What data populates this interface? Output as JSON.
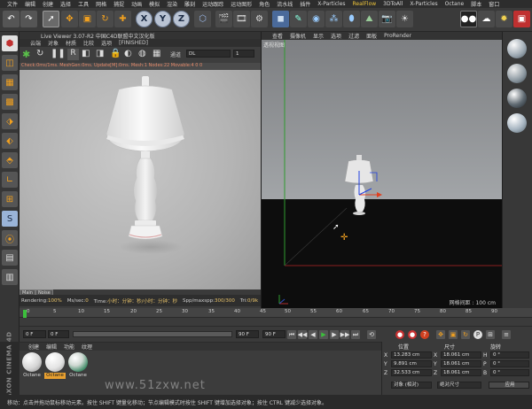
{
  "menubar": {
    "items": [
      "文件",
      "编辑",
      "创建",
      "选择",
      "工具",
      "网格",
      "捕捉",
      "动画",
      "模拟",
      "渲染",
      "雕刻",
      "运动跟踪",
      "运动图形",
      "角色",
      "流水线",
      "插件",
      "X-Particles",
      "RealFlow",
      "3DToAll",
      "X-Particles",
      "Octane",
      "脚本",
      "窗口"
    ]
  },
  "toolbar": {
    "axis_x": "X",
    "axis_y": "Y",
    "axis_z": "Z"
  },
  "live_viewer": {
    "title": "Live Viewer 3.07-R2 中国C4D联盟中文汉化版",
    "menu": [
      "云端",
      "对象",
      "材质",
      "比较",
      "选项",
      "[FINISHED]"
    ],
    "channel_label": "通道",
    "channel_value": "DL",
    "channel_num": "1",
    "status": "Check:0ms/1ms. MeshGen:0ms. Update[M]:0ms. Mesh:1 Nodes:22 Movable:4  0 0",
    "tabs": [
      "Main",
      "Noise"
    ],
    "info": {
      "rendering_label": "Rendering:",
      "rendering_value": "100%",
      "ms_label": "Ms/sec:",
      "ms_value": "0",
      "time_label": "Time:",
      "time_value": "小时：分钟：秒/小时：分钟：秒",
      "spp_label": "Spp/maxspp:",
      "spp_value": "300/300",
      "tri_label": "Tri:",
      "tri_value": "0/9k"
    }
  },
  "viewport": {
    "menu": [
      "查看",
      "摄像机",
      "显示",
      "选项",
      "过滤",
      "面板",
      "ProRender"
    ],
    "label": "透视视图",
    "grid": "网格间距 : 100 cm"
  },
  "timeline": {
    "ticks": [
      "0",
      "5",
      "10",
      "15",
      "20",
      "25",
      "30",
      "35",
      "40",
      "45",
      "50",
      "55",
      "60",
      "65",
      "70",
      "75",
      "80",
      "85",
      "90"
    ],
    "frame_start": "0 F",
    "frame_current": "0 F",
    "frame_end": "90 F",
    "frame_end2": "90 F"
  },
  "materials": {
    "menu": [
      "创建",
      "编辑",
      "功能",
      "纹理"
    ],
    "items": [
      {
        "label": "Octane",
        "selected": false,
        "color": "#e8e8e8"
      },
      {
        "label": "Octane",
        "selected": true,
        "color": "#f0f0f0"
      },
      {
        "label": "Octane",
        "selected": false,
        "color": "#4a8a6a"
      }
    ]
  },
  "coordinates": {
    "headers": [
      "位置",
      "尺寸",
      "旋转"
    ],
    "rows": [
      {
        "axis": "X",
        "pos": "13.283 cm",
        "size": "18.061 cm",
        "rot_axis": "H",
        "rot": "0 °"
      },
      {
        "axis": "Y",
        "pos": "9.891 cm",
        "size": "18.061 cm",
        "rot_axis": "P",
        "rot": "0 °"
      },
      {
        "axis": "Z",
        "pos": "32.533 cm",
        "size": "18.061 cm",
        "rot_axis": "B",
        "rot": "0 °"
      }
    ],
    "mode_object": "对象 (相对)",
    "mode_size": "绝对尺寸",
    "apply": "应用"
  },
  "brand": "MAXON CINEMA 4D",
  "watermark": "www.51zxw.net",
  "statusbar": "移动：点击并拖动鼠标移动元素。按住 SHIFT 键量化移动；节点编辑模式时按住 SHIFT 键增加选择对象；按住 CTRL 键减少选择对象。"
}
